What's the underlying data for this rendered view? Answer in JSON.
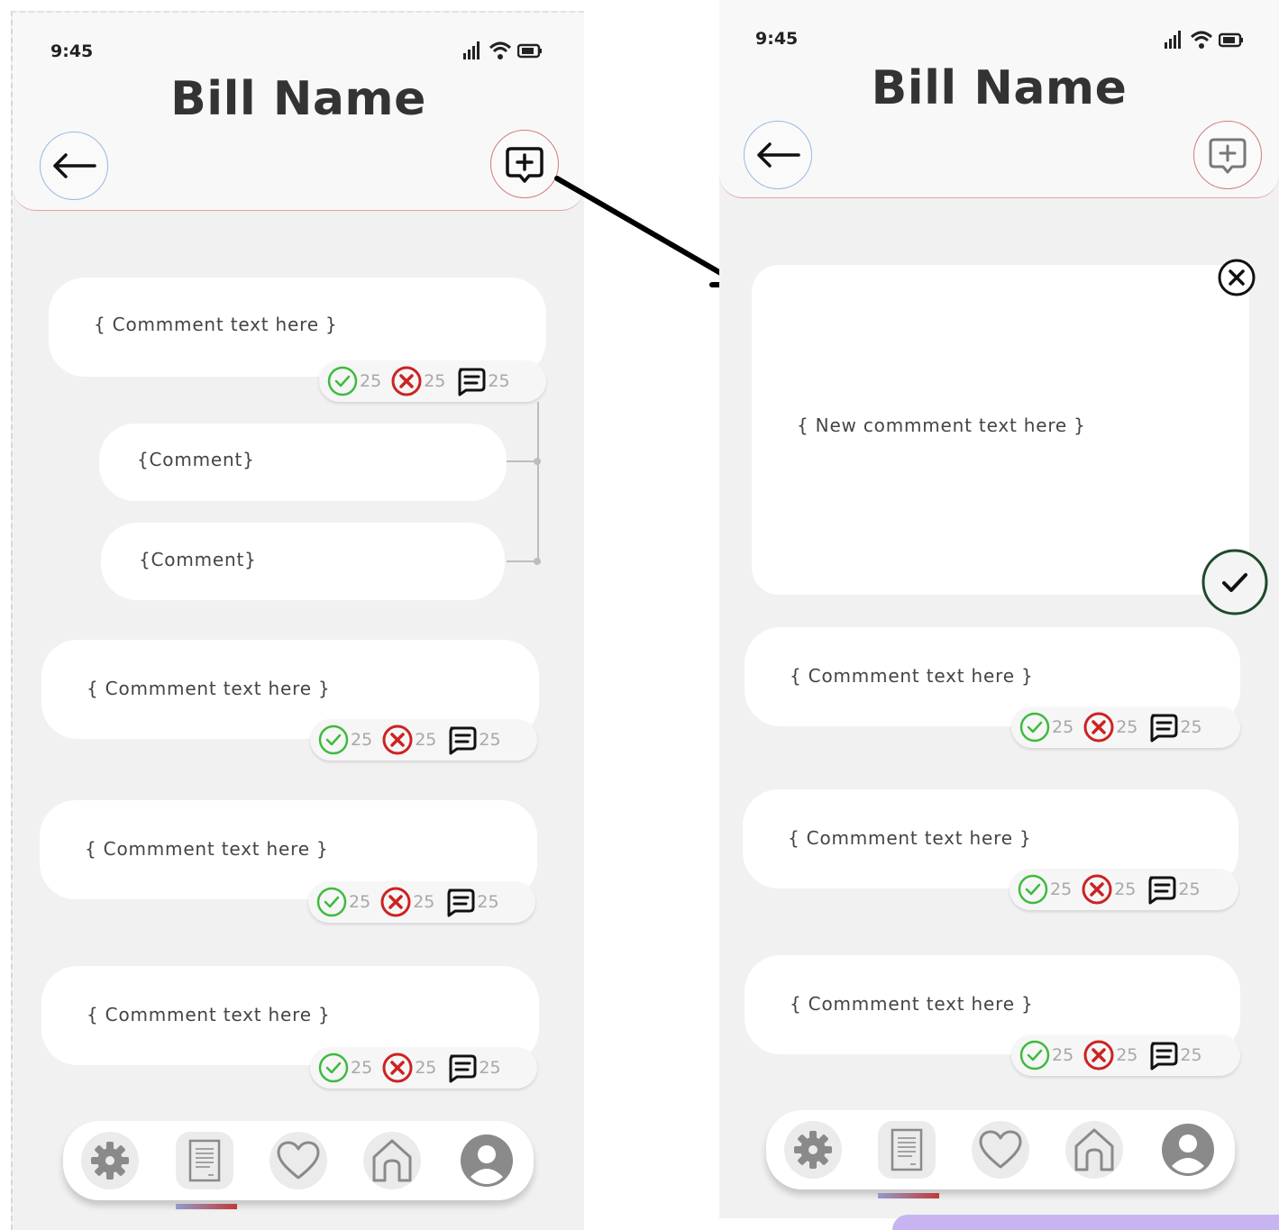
{
  "status_bar": {
    "time": "9:45"
  },
  "header": {
    "title": "Bill Name"
  },
  "new_comment": {
    "placeholder": "{ New commment text here }"
  },
  "left_screen": {
    "threads": [
      {
        "text": "{ Commment text here }",
        "approve": "25",
        "reject": "25",
        "replies": "25",
        "reply_items": [
          {
            "text": "{Comment}"
          },
          {
            "text": "{Comment}"
          }
        ]
      },
      {
        "text": "{ Commment text here }",
        "approve": "25",
        "reject": "25",
        "replies": "25"
      },
      {
        "text": "{ Commment text here }",
        "approve": "25",
        "reject": "25",
        "replies": "25"
      },
      {
        "text": "{ Commment text here }",
        "approve": "25",
        "reject": "25",
        "replies": "25"
      }
    ]
  },
  "right_screen": {
    "threads": [
      {
        "text": "{ Commment text here }",
        "approve": "25",
        "reject": "25",
        "replies": "25"
      },
      {
        "text": "{ Commment text here }",
        "approve": "25",
        "reject": "25",
        "replies": "25"
      },
      {
        "text": "{ Commment text here }",
        "approve": "25",
        "reject": "25",
        "replies": "25"
      }
    ]
  },
  "colors": {
    "approve": "#3dbb3d",
    "reject": "#cc2222",
    "header_border": "#e0a3a3",
    "back_border": "#9ab8e0",
    "add_border": "#d47b7b",
    "confirm_border": "#1f4a2a",
    "count_text": "#a8a8a8",
    "nav_icon": "#8a8a8a"
  },
  "icons": [
    "signal-icon",
    "wifi-icon",
    "battery-icon",
    "back-arrow-icon",
    "add-comment-icon",
    "check-circle-icon",
    "x-circle-icon",
    "comment-icon",
    "close-icon",
    "confirm-check-icon",
    "settings-icon",
    "document-icon",
    "heart-icon",
    "home-icon",
    "profile-icon"
  ]
}
